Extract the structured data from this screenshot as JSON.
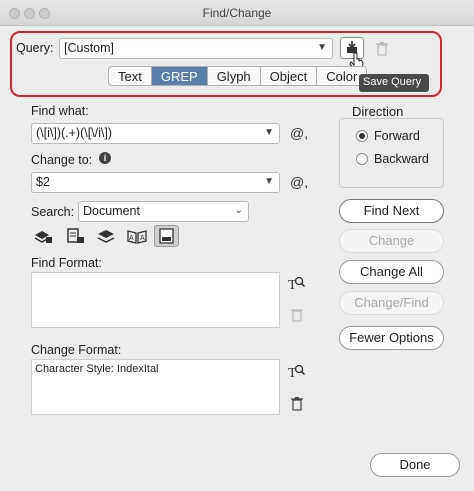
{
  "window": {
    "title": "Find/Change"
  },
  "query": {
    "label": "Query:",
    "value": "[Custom]"
  },
  "tooltip": "Save Query",
  "tabs": [
    {
      "label": "Text",
      "active": false
    },
    {
      "label": "GREP",
      "active": true
    },
    {
      "label": "Glyph",
      "active": false
    },
    {
      "label": "Object",
      "active": false
    },
    {
      "label": "Color",
      "active": false
    }
  ],
  "find_what": {
    "label": "Find what:",
    "value": "(\\[i\\])(.+)(\\[\\/i\\])"
  },
  "change_to": {
    "label": "Change to:",
    "value": "$2"
  },
  "search": {
    "label": "Search:",
    "value": "Document"
  },
  "find_format": {
    "label": "Find Format:",
    "value": ""
  },
  "change_format": {
    "label": "Change Format:",
    "value": "Character Style: IndexItal"
  },
  "direction": {
    "label": "Direction",
    "forward": "Forward",
    "backward": "Backward"
  },
  "buttons": {
    "find_next": "Find Next",
    "change": "Change",
    "change_all": "Change All",
    "change_find": "Change/Find",
    "fewer_options": "Fewer Options",
    "done": "Done"
  },
  "at_symbol": "@,",
  "info_symbol": "i",
  "icons": {
    "save_query": "save-query-icon",
    "delete_query": "trash-icon",
    "locked_layers": "locked-layers-icon",
    "locked_stories": "locked-stories-icon",
    "hidden_layers": "hidden-layers-icon",
    "master_pages": "master-pages-icon",
    "footnotes": "footnotes-icon",
    "specify_format": "format-search-icon"
  },
  "colors": {
    "highlight": "#d0262b",
    "active_tab": "#5a7fa8"
  }
}
